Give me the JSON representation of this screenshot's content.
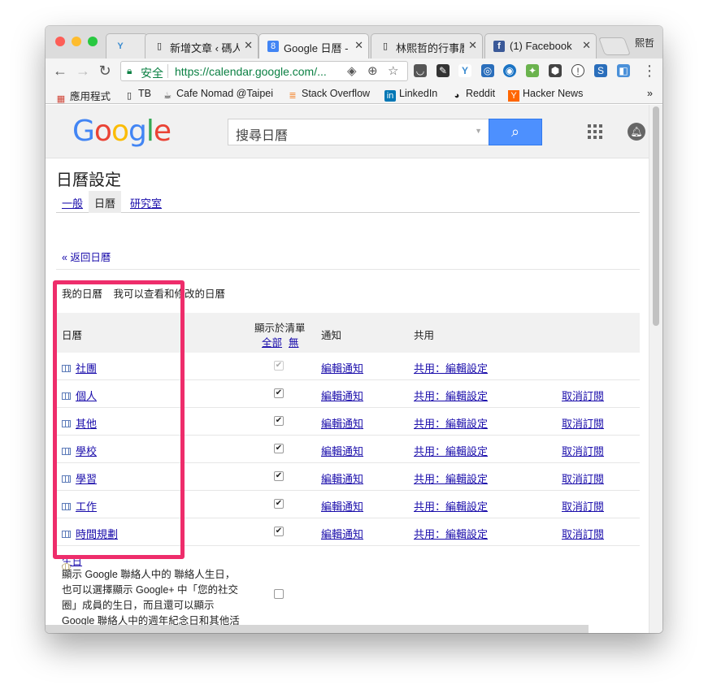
{
  "browser": {
    "tabs": [
      {
        "label": "",
        "icon": "Y",
        "active": false
      },
      {
        "label": "新增文章 ‹ 碼人",
        "icon": "doc",
        "active": false
      },
      {
        "label": "Google 日曆 - ",
        "icon": "8",
        "active": true
      },
      {
        "label": "林熙哲的行事曆",
        "icon": "doc",
        "active": false
      },
      {
        "label": "(1) Facebook",
        "icon": "f",
        "active": false
      }
    ],
    "profile": "熙哲",
    "secure_label": "安全",
    "url": "https://calendar.google.com/...",
    "bookmarks": [
      {
        "label": "應用程式",
        "icon": "apps-icon"
      },
      {
        "label": "TB",
        "icon": "page-icon"
      },
      {
        "label": "Cafe Nomad @Taipei",
        "icon": "cafe-icon"
      },
      {
        "label": "Stack Overflow",
        "icon": "stackoverflow-icon"
      },
      {
        "label": "LinkedIn",
        "icon": "linkedin-icon"
      },
      {
        "label": "Reddit",
        "icon": "reddit-icon"
      },
      {
        "label": "Hacker News",
        "icon": "hackernews-icon"
      }
    ],
    "bookmarks_overflow": "»"
  },
  "header": {
    "logo": "Google",
    "search_placeholder": "搜尋日曆"
  },
  "page": {
    "title": "日曆設定",
    "tabs": [
      {
        "label": "一般",
        "selected": false
      },
      {
        "label": "日曆",
        "selected": true
      },
      {
        "label": "研究室",
        "selected": false
      }
    ],
    "back_link": "« 返回日曆",
    "section_title": "我的日曆",
    "section_desc": "我可以查看和修改的日曆"
  },
  "table": {
    "headers": {
      "calendar": "日曆",
      "show_in_list": "顯示於清單",
      "all": "全部",
      "none": "無",
      "notify": "通知",
      "share": "共用"
    },
    "rows": [
      {
        "name": "社團",
        "checked": true,
        "disabled": true,
        "notify": "編輯通知",
        "share": "共用：編輯設定",
        "unsubscribe": ""
      },
      {
        "name": "個人",
        "checked": true,
        "disabled": false,
        "notify": "編輯通知",
        "share": "共用：編輯設定",
        "unsubscribe": "取消訂閱"
      },
      {
        "name": "其他",
        "checked": true,
        "disabled": false,
        "notify": "編輯通知",
        "share": "共用：編輯設定",
        "unsubscribe": "取消訂閱"
      },
      {
        "name": "學校",
        "checked": true,
        "disabled": false,
        "notify": "編輯通知",
        "share": "共用：編輯設定",
        "unsubscribe": "取消訂閱"
      },
      {
        "name": "學習",
        "checked": true,
        "disabled": false,
        "notify": "編輯通知",
        "share": "共用：編輯設定",
        "unsubscribe": "取消訂閱"
      },
      {
        "name": "工作",
        "checked": true,
        "disabled": false,
        "notify": "編輯通知",
        "share": "共用：編輯設定",
        "unsubscribe": "取消訂閱"
      },
      {
        "name": "時間規劃",
        "checked": true,
        "disabled": false,
        "notify": "編輯通知",
        "share": "共用：編輯設定",
        "unsubscribe": "取消訂閱"
      }
    ],
    "birthday": {
      "name": "生日",
      "checked": false,
      "desc": "顯示 Google 聯絡人中的 聯絡人生日，也可以選擇顯示 Google+ 中「您的社交圈」成員的生日，而且還可以顯示 Google 聯絡人中的週年紀念日和其他活動日期 (如果有的話)。"
    }
  },
  "colors": {
    "highlight": "#ee2d6b",
    "link": "#1a0dab",
    "search_button": "#4d90fe"
  }
}
